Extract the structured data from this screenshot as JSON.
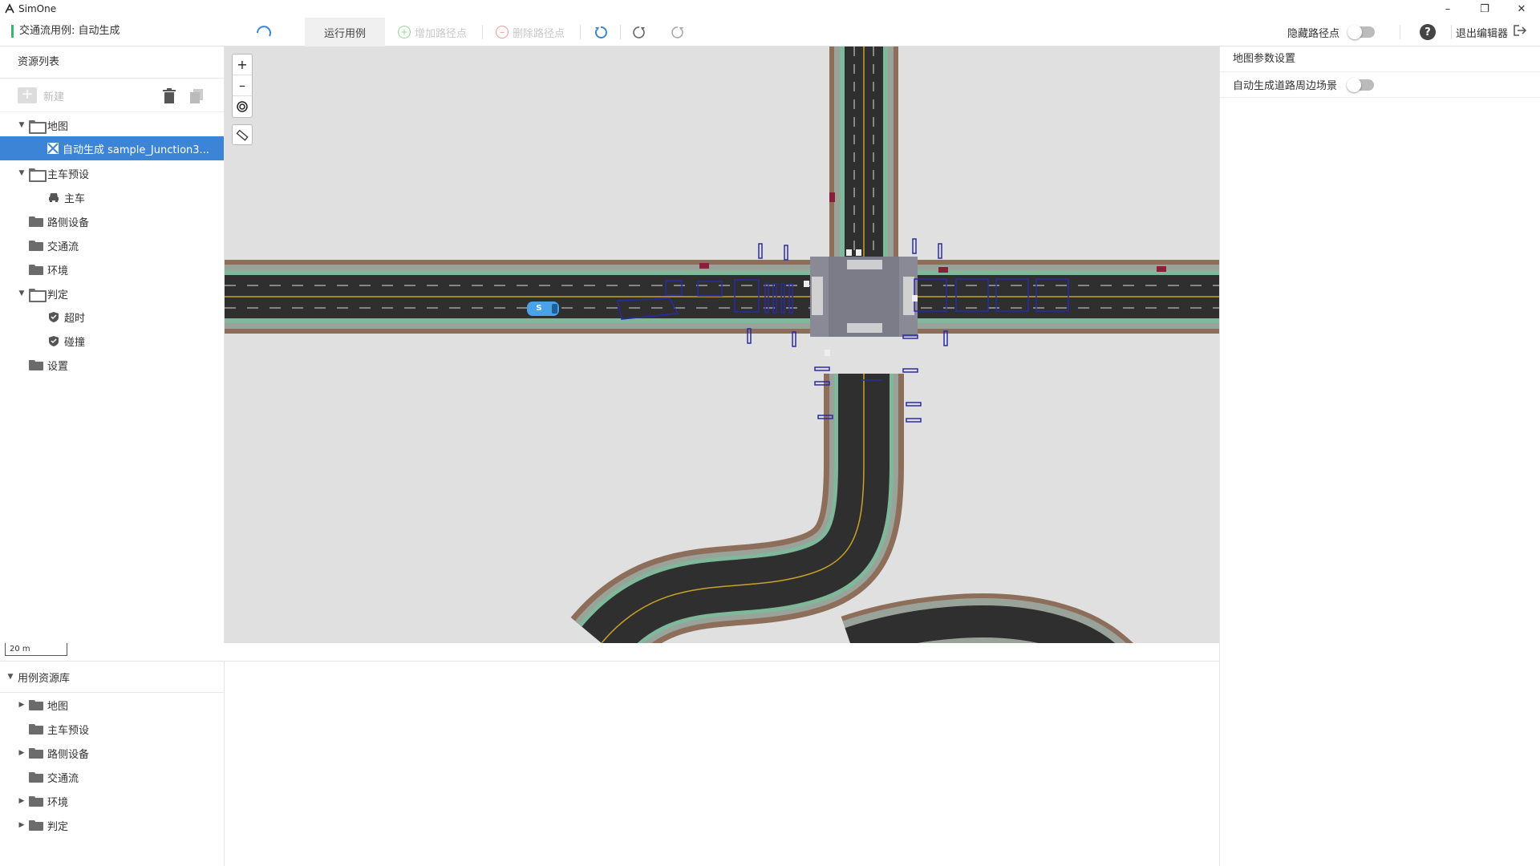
{
  "app": {
    "name": "SimOne",
    "case_title": "交通流用例: 自动生成"
  },
  "toolbar": {
    "run_case": "运行用例",
    "add_waypoint": "增加路径点",
    "delete_waypoint": "删除路径点",
    "hide_waypoint": "隐藏路径点",
    "exit_editor": "退出编辑器"
  },
  "resource_panel": {
    "title": "资源列表",
    "new_label": "新建",
    "tree": {
      "map": "地图",
      "map_item": "自动生成 sample_Junction3...",
      "ego_preset": "主车预设",
      "ego": "主车",
      "roadside": "路侧设备",
      "traffic": "交通流",
      "environment": "环境",
      "judge": "判定",
      "timeout": "超时",
      "collision": "碰撞",
      "settings": "设置"
    }
  },
  "library_panel": {
    "title": "用例资源库",
    "items": [
      "地图",
      "主车预设",
      "路侧设备",
      "交通流",
      "环境",
      "判定"
    ]
  },
  "right_panel": {
    "title": "地图参数设置",
    "auto_roadside_label": "自动生成道路周边场景"
  },
  "map": {
    "scale_label": "20 m",
    "ego_label": "S"
  },
  "colors": {
    "accent": "#3c85d6",
    "road_asphalt": "#2f2f2f",
    "road_shoulder": "#8d6e5a",
    "sidewalk": "#9aa39a",
    "lane_green": "#7fb89a",
    "map_background": "#e0e0e0",
    "ego_vehicle": "#4aa3e8",
    "trigger_outline": "#2a2aa8"
  },
  "icons": [
    "simone-logo-icon",
    "minimize-icon",
    "restore-icon",
    "close-icon",
    "loading-spinner-icon",
    "add-circle-icon",
    "remove-circle-icon",
    "undo-icon",
    "redo-icon",
    "reset-icon",
    "help-icon",
    "exit-icon",
    "new-icon",
    "trash-icon",
    "copy-icon",
    "map-icon",
    "car-icon",
    "shield-icon",
    "zoom-in-icon",
    "zoom-out-icon",
    "locate-icon",
    "ruler-icon"
  ]
}
